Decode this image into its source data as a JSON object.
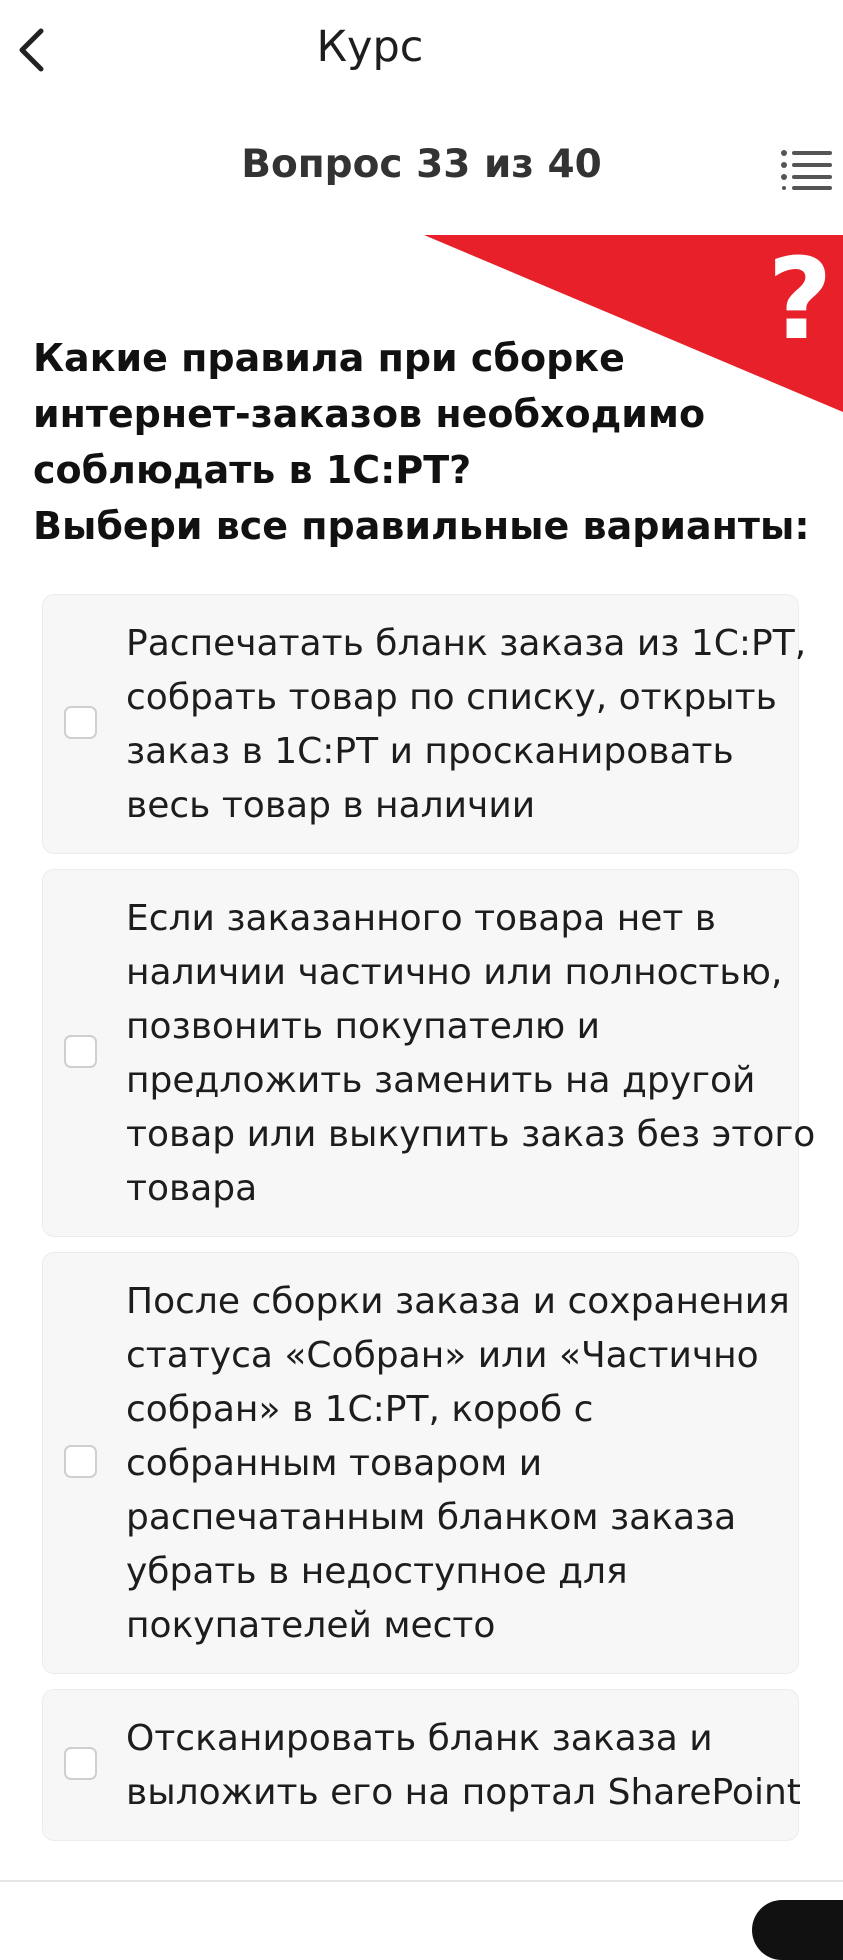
{
  "header": {
    "title": "Курс",
    "back_icon": "chevron-left-icon"
  },
  "question_header": {
    "label": "Вопрос 33 из 40",
    "menu_icon": "list-menu-icon"
  },
  "banner": {
    "color": "#e8202a",
    "icon": "question-mark-icon",
    "symbol": "?"
  },
  "question": {
    "lines": [
      "Какие правила при сборке",
      "интернет-заказов необходимо",
      "соблюдать в 1С:РТ?",
      "Выбери все правильные варианты:"
    ]
  },
  "options": [
    {
      "checked": false,
      "lines": [
        "Распечатать бланк заказа из 1С:РТ,",
        "собрать товар по списку, открыть",
        "заказ в 1С:РТ и просканировать",
        "весь товар в наличии"
      ]
    },
    {
      "checked": false,
      "lines": [
        "Если заказанного товара нет в",
        "наличии частично или полностью,",
        "позвонить покупателю и",
        "предложить заменить на другой",
        "товар или выкупить заказ без этого",
        "товара"
      ]
    },
    {
      "checked": false,
      "lines": [
        "После сборки заказа и сохранения",
        "статуса «Собран» или «Частично",
        "собран» в 1С:РТ, короб с",
        "собранным товаром и",
        "распечатанным бланком заказа",
        "убрать в недоступное для",
        "покупателей место"
      ]
    },
    {
      "checked": false,
      "lines": [
        "Отсканировать бланк заказа и",
        "выложить его на портал SharePoint"
      ]
    }
  ]
}
